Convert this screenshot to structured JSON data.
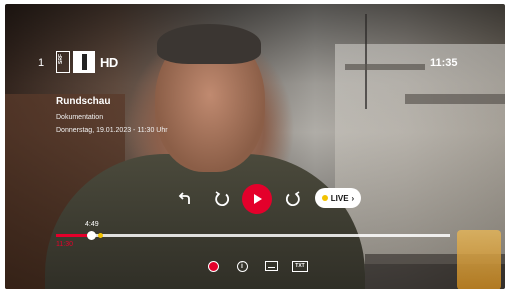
{
  "channel": {
    "number": "1",
    "logo_text": "SRF",
    "hd_label": "HD"
  },
  "clock": "11:35",
  "program": {
    "title": "Rundschau",
    "genre": "Dokumentation",
    "airdate": "Donnerstag, 19.01.2023 - 11:30 Uhr"
  },
  "controls": {
    "back_icon": "back-arrow-icon",
    "rewind_icon": "rewind-icon",
    "play_icon": "play-icon",
    "forward_icon": "forward-icon",
    "live_label": "LIVE"
  },
  "progress": {
    "current_time": "4:49",
    "start_time": "11:30",
    "played_fraction": 0.09,
    "live_marker_fraction": 0.112
  },
  "bottom_icons": {
    "record": "record-icon",
    "info": "info-icon",
    "subtitles": "subtitles-icon",
    "teletext_label": "TXT"
  },
  "colors": {
    "accent": "#e4002b",
    "live_dot": "#f2c200"
  }
}
